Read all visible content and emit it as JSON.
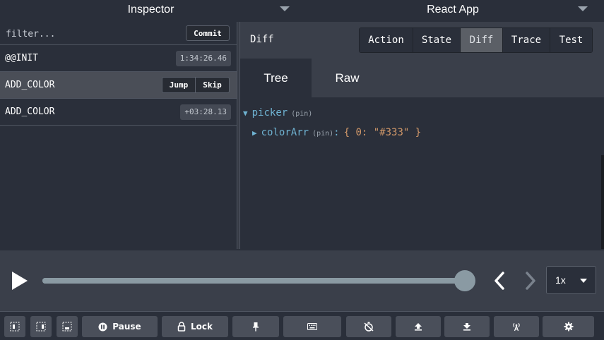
{
  "header": {
    "left_select": "Inspector",
    "right_select": "React App"
  },
  "actions": {
    "filter_placeholder": "filter...",
    "commit_label": "Commit",
    "items": [
      {
        "name": "@@INIT",
        "time": "1:34:26.46"
      },
      {
        "name": "ADD_COLOR",
        "jump_label": "Jump",
        "skip_label": "Skip"
      },
      {
        "name": "ADD_COLOR",
        "time": "+03:28.13"
      }
    ]
  },
  "monitor": {
    "title": "Diff",
    "tabs": [
      "Action",
      "State",
      "Diff",
      "Trace",
      "Test"
    ],
    "active_tab": "Diff",
    "subtabs": [
      "Tree",
      "Raw"
    ],
    "active_subtab": "Tree"
  },
  "tree": {
    "root_key": "picker",
    "root_pin": "(pin)",
    "child_key": "colorArr",
    "child_pin": "(pin)",
    "child_colon": ":",
    "child_value": "{ 0: \"#333\" }"
  },
  "slider": {
    "position_fraction": 1.0,
    "speed": "1x"
  },
  "footer": {
    "pause_label": "Pause",
    "lock_label": "Lock"
  },
  "colors": {
    "background": "#2a2f3a",
    "panel": "#3a3f4a",
    "key_blue": "#6fb3d2",
    "value_orange": "#d49a6a",
    "slider": "#8a9aa3"
  }
}
